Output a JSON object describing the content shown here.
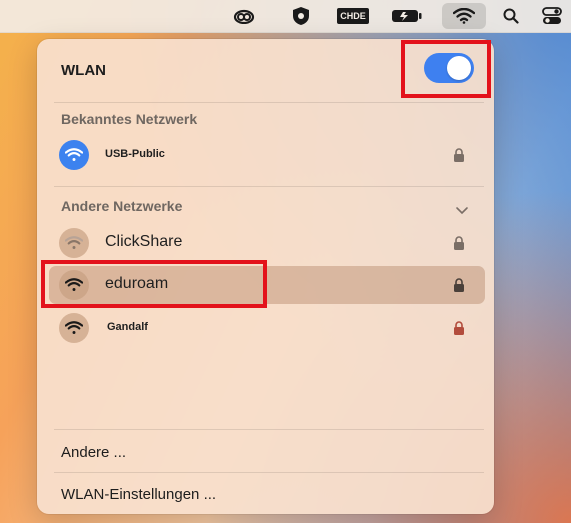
{
  "panel": {
    "title": "WLAN",
    "toggle_on": true,
    "known_section": "Bekanntes Netzwerk",
    "known_networks": [
      {
        "name": "USB-Public",
        "icon": "wifi-icon",
        "locked": true
      }
    ],
    "other_section": "Andere Netzwerke",
    "other_networks": [
      {
        "name": "ClickShare",
        "icon": "wifi-icon",
        "locked": true
      },
      {
        "name": "eduroam",
        "icon": "wifi-icon",
        "locked": true,
        "selected": true
      },
      {
        "name": "Gandalf",
        "icon": "wifi-icon",
        "locked": true
      }
    ],
    "other_item": "Andere ...",
    "settings_item": "WLAN-Einstellungen ..."
  },
  "menubar": {
    "badge_text": "CHDE"
  },
  "colors": {
    "toggle": "#3e80f0",
    "highlight_box": "#e3121b",
    "selected_row": "#c89b80"
  }
}
